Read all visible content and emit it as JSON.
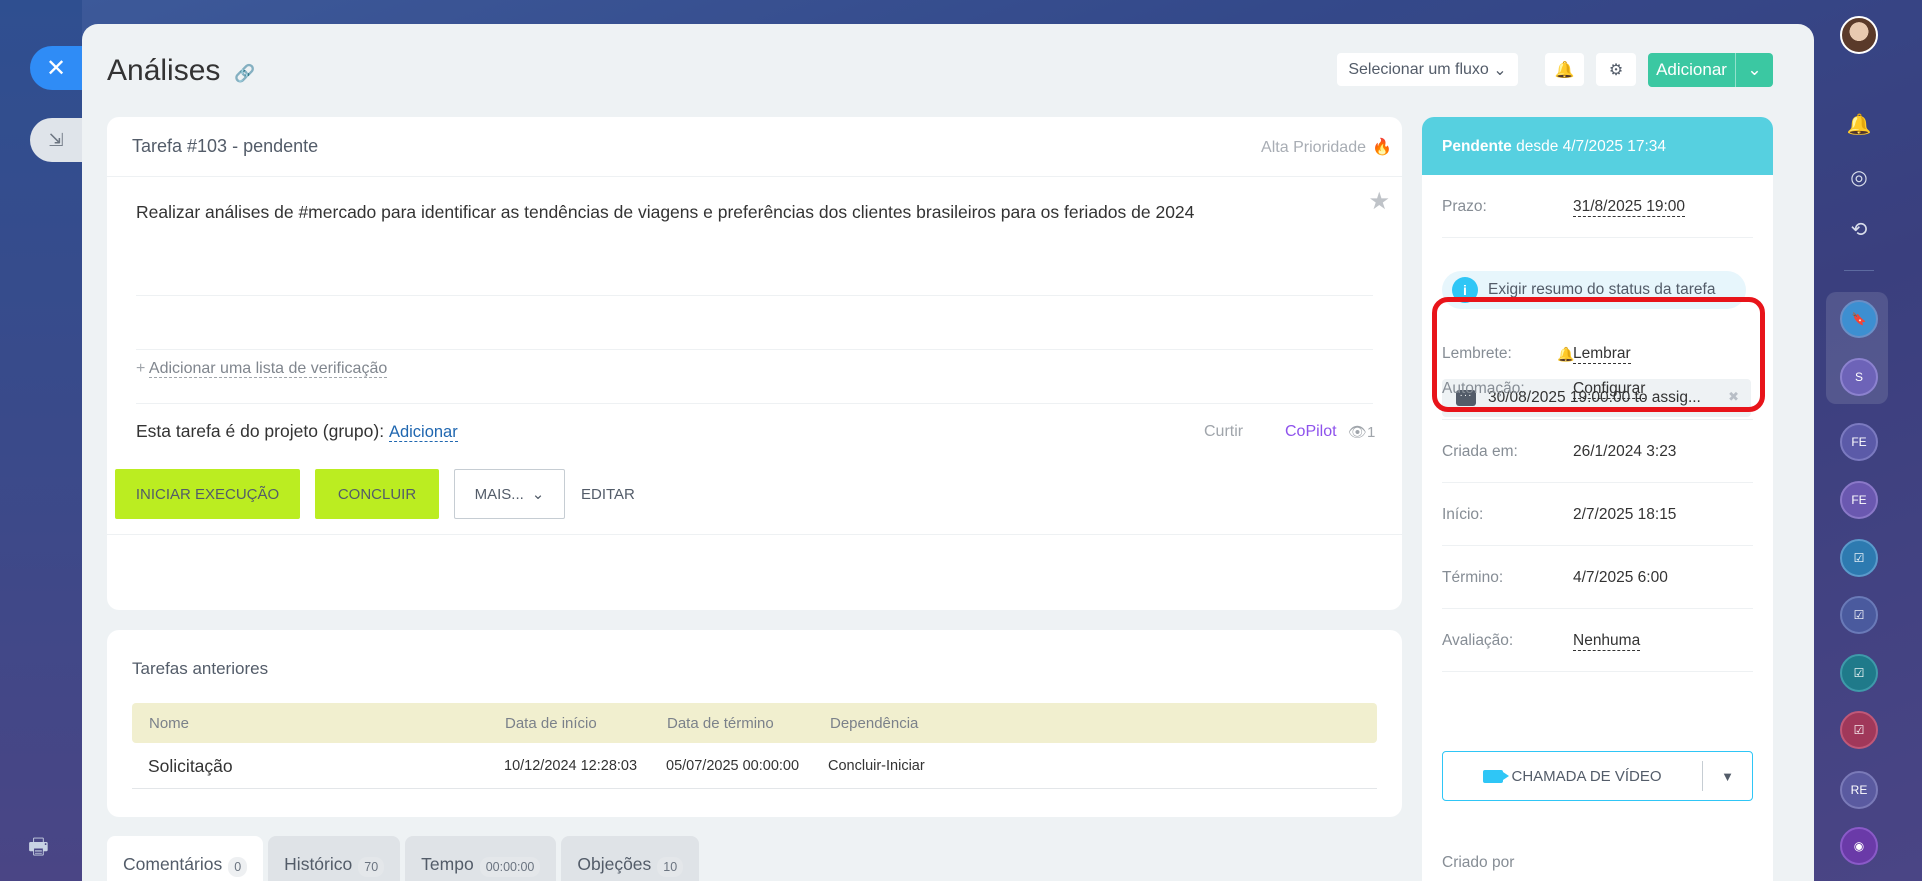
{
  "page": {
    "title": "Análises"
  },
  "header": {
    "flow_select": "Selecionar um fluxo",
    "add_label": "Adicionar"
  },
  "task": {
    "title": "Tarefa #103 - pendente",
    "priority": "Alta Prioridade",
    "description": "Realizar análises de #mercado para identificar as tendências de viagens e preferências dos clientes brasileiros para os feriados de 2024",
    "checklist_prefix": "+",
    "checklist_link": "Adicionar uma lista de verificação",
    "project_text": "Esta tarefa é do projeto (grupo):",
    "project_link": "Adicionar",
    "like": "Curtir",
    "copilot": "CoPilot",
    "views": "1"
  },
  "actions": {
    "start": "INICIAR EXECUÇÃO",
    "complete": "CONCLUIR",
    "more": "MAIS...",
    "edit": "EDITAR"
  },
  "previous": {
    "title": "Tarefas anteriores",
    "columns": [
      "Nome",
      "Data de início",
      "Data de término",
      "Dependência"
    ],
    "rows": [
      {
        "name": "Solicitação",
        "start": "10/12/2024 12:28:03",
        "end": "05/07/2025 00:00:00",
        "dep": "Concluir-Iniciar"
      }
    ]
  },
  "tabs": [
    {
      "label": "Comentários",
      "count": "0"
    },
    {
      "label": "Histórico",
      "count": "70"
    },
    {
      "label": "Tempo",
      "count": "00:00:00"
    },
    {
      "label": "Objeções",
      "count": "10"
    }
  ],
  "sidebar": {
    "status_bold": "Pendente",
    "status_rest": "desde 4/7/2025 17:34",
    "deadline_label": "Prazo:",
    "deadline_value": "31/8/2025 19:00",
    "info": "Exigir resumo do status da tarefa",
    "reminder_label": "Lembrete:",
    "reminder_link": "Lembrar",
    "reminder_item": "30/08/2025 19:00:00 to assig...",
    "automation_label": "Automação:",
    "automation_value": "Configurar",
    "created_label": "Criada em:",
    "created_value": "26/1/2024 3:23",
    "start_label": "Início:",
    "start_value": "2/7/2025 18:15",
    "end_label": "Término:",
    "end_value": "4/7/2025 6:00",
    "rating_label": "Avaliação:",
    "rating_value": "Nenhuma",
    "video_call": "CHAMADA DE VÍDEO",
    "created_by": "Criado por"
  },
  "right_bar": {
    "initials": [
      "S",
      "FE",
      "FE",
      "RE"
    ]
  },
  "colors": {
    "accent_green": "#bbed21",
    "status_cyan": "#56d0e0",
    "add_button": "#3bc8a2",
    "highlight": "#e8141a",
    "copilot": "#8e52ec"
  }
}
